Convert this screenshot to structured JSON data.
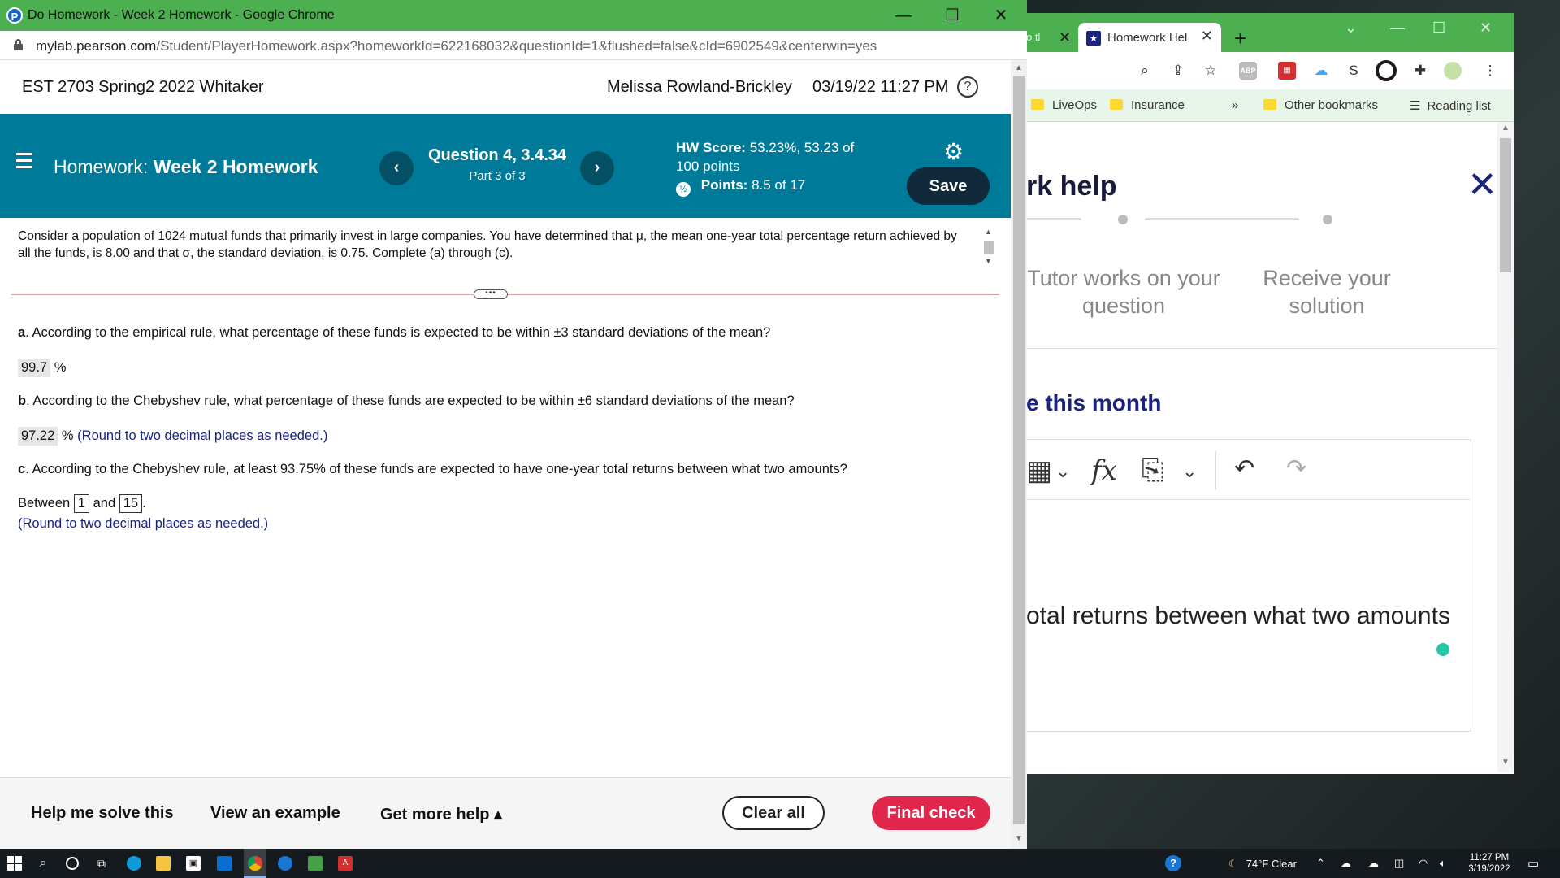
{
  "background_window": {
    "tab_prev_label": "o tl",
    "tab_active_label": "Homework Hel",
    "bookmarks": [
      "LiveOps",
      "Insurance",
      "»",
      "Other bookmarks",
      "Reading list"
    ],
    "panel_title": "rk help",
    "steps": [
      "Tutor works on your question",
      "Receive your solution"
    ],
    "month_text": "e this month",
    "editor_text": "otal returns between what two amounts"
  },
  "window": {
    "title": "Do Homework - Week 2 Homework - Google Chrome",
    "url_host": "mylab.pearson.com",
    "url_path": "/Student/PlayerHomework.aspx?homeworkId=622168032&questionId=1&flushed=false&cId=6902549&centerwin=yes"
  },
  "header": {
    "course": "EST 2703 Spring2 2022 Whitaker",
    "user": "Melissa Rowland-Brickley",
    "datetime": "03/19/22 11:27 PM",
    "help_symbol": "?"
  },
  "hw_bar": {
    "homework_prefix": "Homework:",
    "homework_name": "Week 2 Homework",
    "question_title": "Question 4, 3.4.34",
    "question_part": "Part 3 of 3",
    "hw_score_label": "HW Score:",
    "hw_score_value": "53.23%, 53.23 of",
    "hw_score_total": "100 points",
    "points_label": "Points:",
    "points_value": "8.5 of 17",
    "save_label": "Save",
    "prev_symbol": "‹",
    "next_symbol": "›"
  },
  "problem": {
    "statement": "Consider a population of 1024 mutual funds that primarily invest in large companies. You have determined that μ, the mean one-year total percentage return achieved by all the funds, is 8.00 and that σ, the standard deviation, is 0.75. Complete (a) through (c)."
  },
  "questions": {
    "a_letter": "a",
    "a_text": ". According to the empirical rule, what percentage of these funds is expected to be within ±3 standard deviations of the mean?",
    "a_answer": "99.7",
    "a_unit": "%",
    "b_letter": "b",
    "b_text": ". According to the Chebyshev rule, what percentage of these funds are expected to be within ±6 standard deviations of the mean?",
    "b_answer": "97.22",
    "b_unit": "%",
    "b_hint": "(Round to two decimal places as needed.)",
    "c_letter": "c",
    "c_text": ". According to the Chebyshev rule, at least 93.75% of these funds are expected to have one-year total returns between what two amounts?",
    "c_between": "Between",
    "c_low": "1",
    "c_and": "and",
    "c_high": "15",
    "c_period": ".",
    "c_hint": "(Round to two decimal places as needed.)"
  },
  "bottom": {
    "help_solve": "Help me solve this",
    "view_example": "View an example",
    "more_help": "Get more help ▴",
    "clear_all": "Clear all",
    "final_check": "Final check"
  },
  "taskbar": {
    "weather": "74°F  Clear",
    "time": "11:27 PM",
    "date": "3/19/2022"
  },
  "colors": {
    "title_bar": "#4caf50",
    "hw_bar": "#007a99",
    "save_button": "#102a3c",
    "final_check": "#e0264b",
    "hint_text": "#1a237e"
  }
}
